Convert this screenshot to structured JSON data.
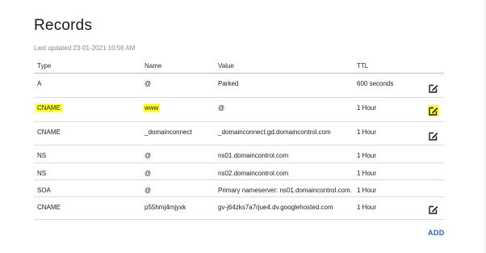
{
  "page": {
    "title": "Records",
    "last_updated": "Last updated 23-01-2021 10:56 AM"
  },
  "table": {
    "headers": {
      "type": "Type",
      "name": "Name",
      "value": "Value",
      "ttl": "TTL"
    },
    "rows": [
      {
        "type": "A",
        "name": "@",
        "value": "Parked",
        "ttl": "600 seconds",
        "editable": true,
        "highlighted": false
      },
      {
        "type": "CNAME",
        "name": "www",
        "value": "@",
        "ttl": "1 Hour",
        "editable": true,
        "highlighted": true
      },
      {
        "type": "CNAME",
        "name": "_domainconnect",
        "value": "_domainconnect.gd.domaincontrol.com",
        "ttl": "1 Hour",
        "editable": true,
        "highlighted": false
      },
      {
        "type": "NS",
        "name": "@",
        "value": "ns01.domaincontrol.com",
        "ttl": "1 Hour",
        "editable": false,
        "highlighted": false
      },
      {
        "type": "NS",
        "name": "@",
        "value": "ns02.domaincontrol.com",
        "ttl": "1 Hour",
        "editable": false,
        "highlighted": false
      },
      {
        "type": "SOA",
        "name": "@",
        "value": "Primary nameserver: ns01.domaincontrol.com.",
        "ttl": "1 Hour",
        "editable": false,
        "highlighted": false
      },
      {
        "type": "CNAME",
        "name": "p55hmj4mjyxk",
        "value": "gv-j64zks7a7rjue4.dv.googlehosted.com",
        "ttl": "1 Hour",
        "editable": true,
        "highlighted": false
      }
    ]
  },
  "actions": {
    "add_label": "ADD"
  },
  "icons": {
    "edit": "edit-pencil-icon"
  },
  "colors": {
    "highlight": "#ffff3a",
    "link": "#1f67b4"
  }
}
